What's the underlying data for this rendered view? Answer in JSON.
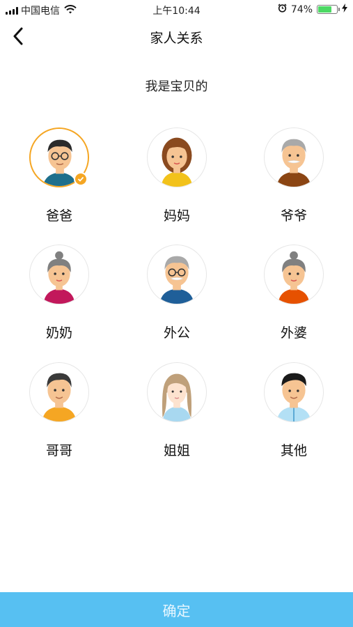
{
  "status_bar": {
    "carrier": "中国电信",
    "time": "上午10:44",
    "battery_percent": "74%",
    "battery_level": 0.74,
    "icons": [
      "signal-icon",
      "wifi-icon",
      "alarm-icon",
      "battery-icon",
      "charging-icon"
    ]
  },
  "nav": {
    "back_icon": "chevron-left-icon",
    "title": "家人关系"
  },
  "subtitle": "我是宝贝的",
  "relations": [
    {
      "label": "爸爸",
      "selected": true
    },
    {
      "label": "妈妈",
      "selected": false
    },
    {
      "label": "爷爷",
      "selected": false
    },
    {
      "label": "奶奶",
      "selected": false
    },
    {
      "label": "外公",
      "selected": false
    },
    {
      "label": "外婆",
      "selected": false
    },
    {
      "label": "哥哥",
      "selected": false
    },
    {
      "label": "姐姐",
      "selected": false
    },
    {
      "label": "其他",
      "selected": false
    }
  ],
  "confirm_label": "确定",
  "colors": {
    "accent": "#f5a623",
    "button_bg": "#57c0f2",
    "button_text": "#e9f7ff",
    "battery_fill": "#4cd964"
  }
}
